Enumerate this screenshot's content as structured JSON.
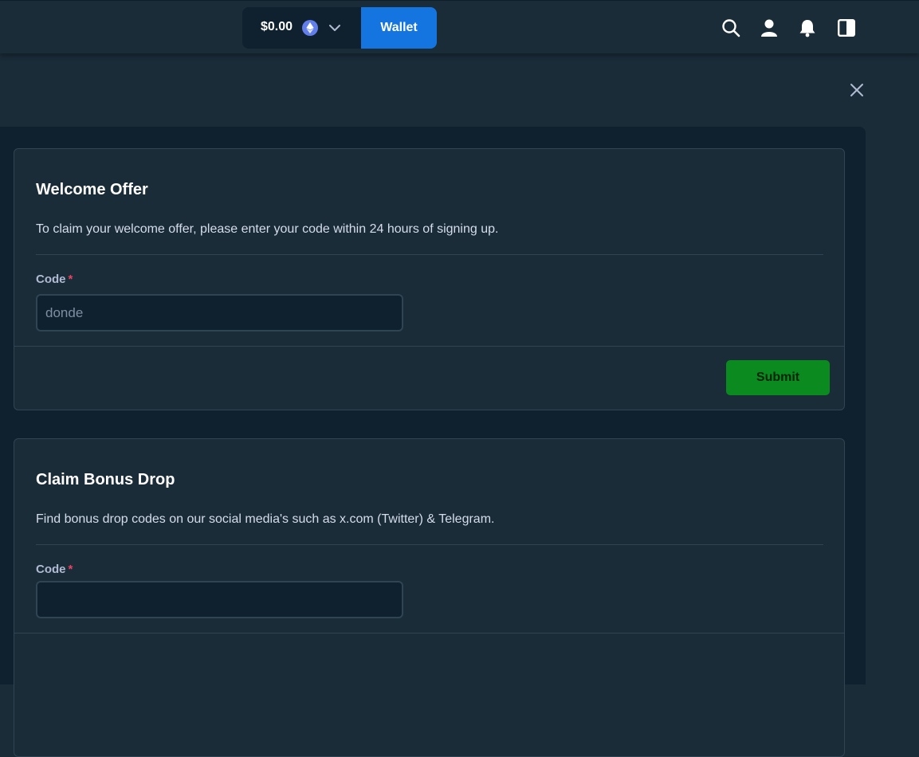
{
  "header": {
    "balance": "$0.00",
    "currency_icon": "ethereum-icon",
    "wallet_label": "Wallet",
    "icons": [
      "search-icon",
      "user-icon",
      "bell-icon",
      "sidebar-toggle-icon"
    ]
  },
  "modal": {
    "close_icon": "close-icon"
  },
  "welcome_offer": {
    "title": "Welcome Offer",
    "description": "To claim your welcome offer, please enter your code within 24 hours of signing up.",
    "code_label": "Code",
    "required_mark": "*",
    "code_placeholder": "donde",
    "submit_label": "Submit"
  },
  "bonus_drop": {
    "title": "Claim Bonus Drop",
    "description": "Find bonus drop codes on our social media's such as x.com (Twitter) & Telegram.",
    "code_label": "Code",
    "required_mark": "*",
    "code_value": ""
  },
  "colors": {
    "background": "#1a2c38",
    "panel": "#0f212e",
    "wallet_blue": "#1475e1",
    "submit_green": "#0a8a1f",
    "required_red": "#ed4163"
  }
}
